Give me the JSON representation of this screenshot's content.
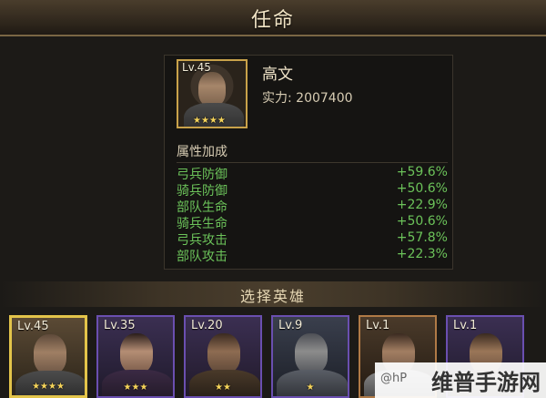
{
  "header": {
    "title": "任命"
  },
  "hero": {
    "level": "Lv.45",
    "stars": "★★★★",
    "name": "高文",
    "power": "实力: 2007400"
  },
  "attributes": {
    "title": "属性加成",
    "rows": [
      {
        "label": "弓兵防御",
        "value": "+59.6%"
      },
      {
        "label": "骑兵防御",
        "value": "+50.6%"
      },
      {
        "label": "部队生命",
        "value": "+22.9%"
      },
      {
        "label": "骑兵生命",
        "value": "+50.6%"
      },
      {
        "label": "弓兵攻击",
        "value": "+57.8%"
      },
      {
        "label": "部队攻击",
        "value": "+22.3%"
      }
    ],
    "value_color": "#6cc35a"
  },
  "selection": {
    "title": "选择英雄",
    "heroes": [
      {
        "level": "Lv.45",
        "stars": "★★★★",
        "selected": true
      },
      {
        "level": "Lv.35",
        "stars": "★★★"
      },
      {
        "level": "Lv.20",
        "stars": "★★"
      },
      {
        "level": "Lv.9",
        "stars": "★"
      },
      {
        "level": "Lv.1",
        "stars": ""
      },
      {
        "level": "Lv.1",
        "stars": ""
      }
    ]
  },
  "watermark": {
    "small": "@hP",
    "big": "维普手游网"
  }
}
